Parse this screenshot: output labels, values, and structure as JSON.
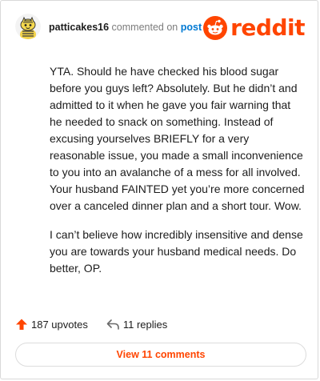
{
  "header": {
    "username": "patticakes16",
    "action_text": "commented on",
    "post_link_label": "post",
    "brand_wordmark": "reddit"
  },
  "comment": {
    "paragraphs": [
      "YTA. Should he have checked his blood sugar before you guys left? Absolutely. But he didn’t and admitted to it when he gave you fair warning that he needed to snack on something. Instead of excusing yourselves BRIEFLY for a very reasonable issue, you made a small inconvenience to you into an avalanche of a mess for all involved. Your husband FAINTED yet you’re more concerned over a canceled dinner plan and a short tour. Wow.",
      "I can’t believe how incredibly insensitive and dense you are towards your husband medical needs. Do better, OP."
    ]
  },
  "footer": {
    "upvotes_label": "187 upvotes",
    "replies_label": "11 replies",
    "view_comments_label": "View 11 comments"
  },
  "colors": {
    "brand_orange": "#ff4500",
    "link_blue": "#0079d3",
    "text_dark": "#1c1c1c",
    "text_muted": "#7c7c7c"
  },
  "icons": {
    "avatar": "snoo-avatar-yellow-striped",
    "brand": "reddit-snoo-icon",
    "upvote": "upvote-arrow-icon",
    "reply": "reply-arrow-icon"
  }
}
